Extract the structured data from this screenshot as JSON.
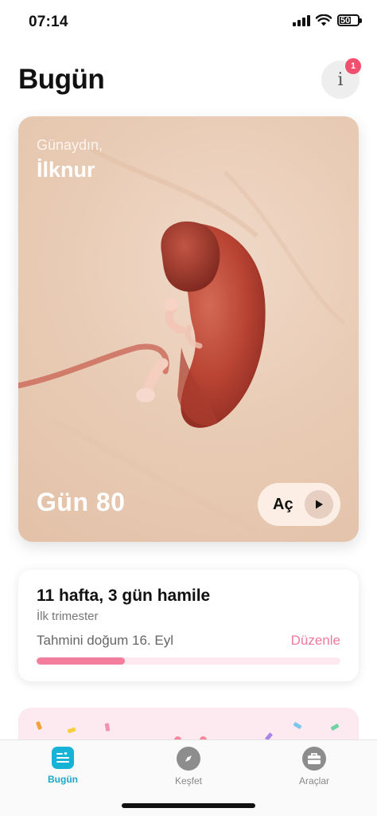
{
  "status_bar": {
    "time": "07:14",
    "battery": "50"
  },
  "header": {
    "title": "Bugün",
    "info_icon": "info-icon",
    "notification_count": "1"
  },
  "hero": {
    "greeting": "Günaydın,",
    "name": "İlknur",
    "day_label": "Gün 80",
    "open_label": "Aç",
    "play_icon": "play-icon"
  },
  "pregnancy": {
    "title": "11 hafta, 3 gün hamile",
    "trimester": "İlk trimester",
    "due_date": "Tahmini doğum 16. Eyl",
    "edit_label": "Düzenle",
    "progress_fraction": 0.29
  },
  "tabs": [
    {
      "label": "Bugün",
      "icon": "today-icon",
      "active": true
    },
    {
      "label": "Keşfet",
      "icon": "compass-icon",
      "active": false
    },
    {
      "label": "Araçlar",
      "icon": "toolbox-icon",
      "active": false
    }
  ],
  "colors": {
    "accent_pink": "#f0799c",
    "accent_blue": "#17b3d6",
    "badge_red": "#f0506e"
  }
}
